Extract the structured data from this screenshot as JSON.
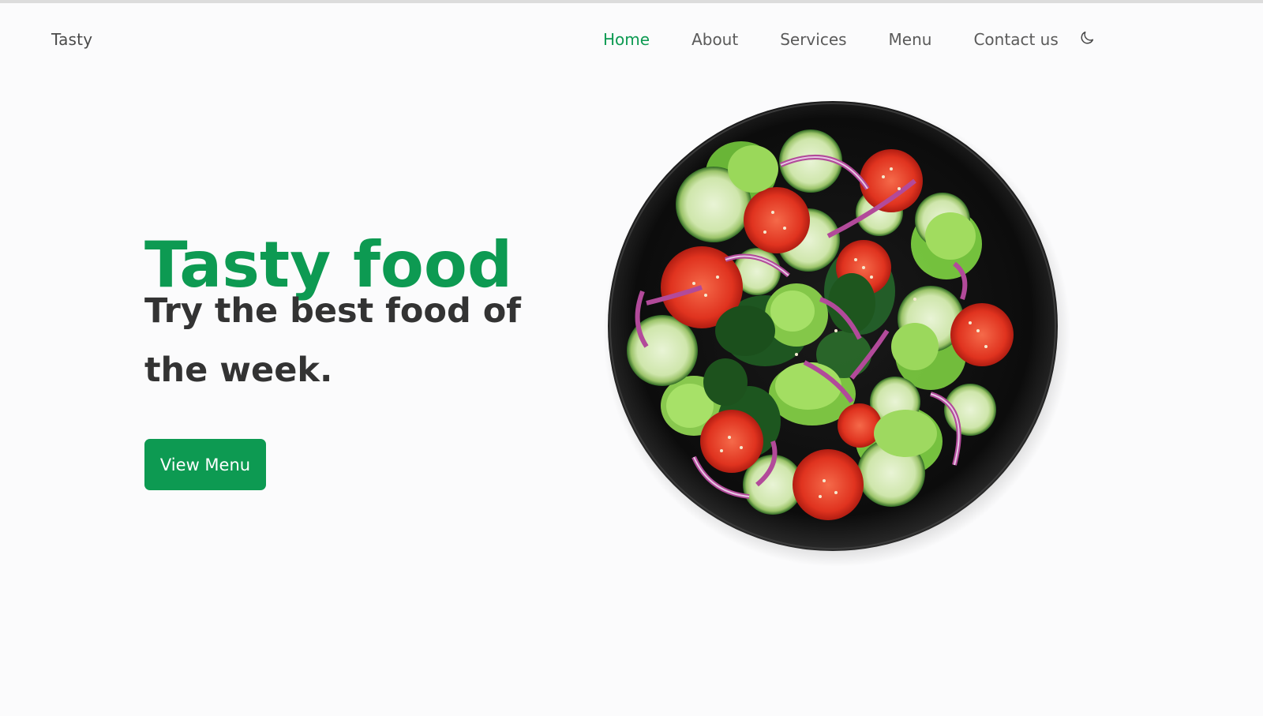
{
  "brand": "Tasty",
  "nav": {
    "items": [
      {
        "label": "Home",
        "active": true
      },
      {
        "label": "About",
        "active": false
      },
      {
        "label": "Services",
        "active": false
      },
      {
        "label": "Menu",
        "active": false
      },
      {
        "label": "Contact us",
        "active": false
      }
    ],
    "theme_icon": "moon-icon"
  },
  "hero": {
    "title": "Tasty food",
    "subtitle": "Try the best food of the week.",
    "cta_label": "View Menu",
    "image": "salad-plate"
  },
  "colors": {
    "accent": "#0d9a52",
    "text_dark": "#333333",
    "text_nav": "#5a5a5a",
    "background": "#fbfbfc"
  }
}
